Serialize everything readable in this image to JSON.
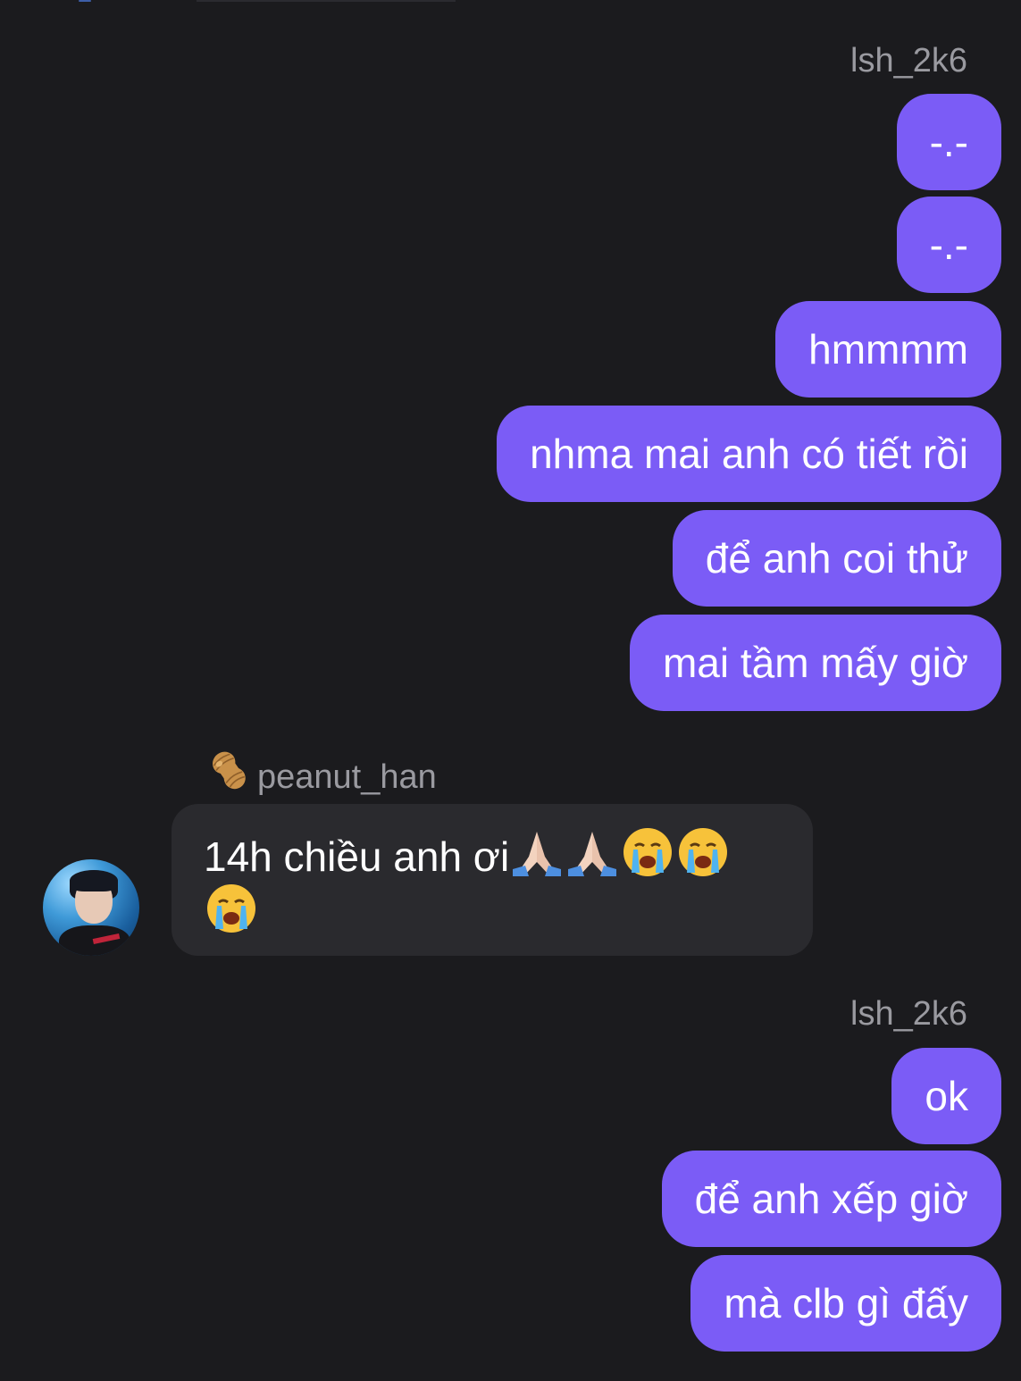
{
  "conversation": {
    "blocks": [
      {
        "sender": "lsh_2k6",
        "messages": [
          "-.-",
          "-.-",
          "hmmmm",
          "nhma mai anh có tiết rồi",
          "để anh coi thử",
          "mai tầm mấy giờ"
        ]
      },
      {
        "sender": "peanut_han",
        "sender_emoji": "peanut-icon",
        "avatar": "profile-photo-avatar",
        "message": "14h chiều anh ơi",
        "message_emojis": [
          "folded-hands-icon",
          "folded-hands-icon",
          "loudly-crying-face-icon",
          "loudly-crying-face-icon",
          "loudly-crying-face-icon"
        ]
      },
      {
        "sender": "lsh_2k6",
        "messages": [
          "ok",
          "để anh xếp giờ",
          "mà clb gì đấy"
        ]
      }
    ]
  },
  "colors": {
    "background": "#1b1b1e",
    "outgoing_bubble": "#7b5cf6",
    "incoming_bubble": "#2a2a2e",
    "sender_name": "#9a9aa0",
    "text": "#ffffff"
  }
}
